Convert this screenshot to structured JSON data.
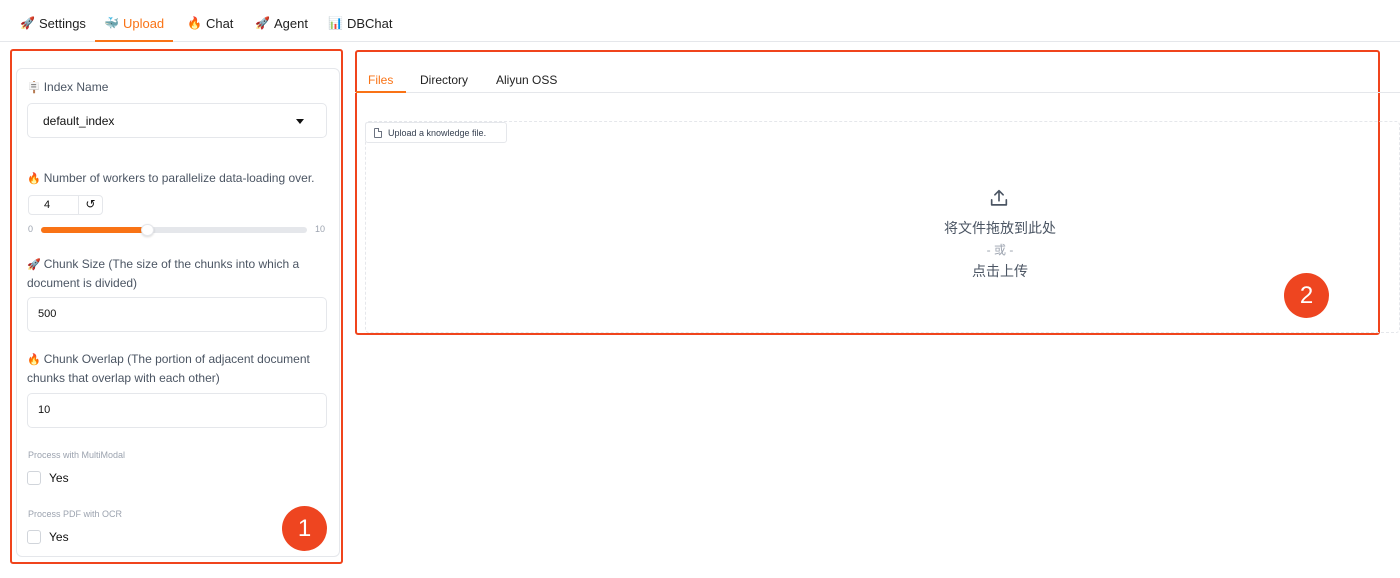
{
  "top_tabs": [
    {
      "emoji": "🚀",
      "label": "Settings"
    },
    {
      "emoji": "🐳",
      "label": "Upload"
    },
    {
      "emoji": "🔥",
      "label": "Chat"
    },
    {
      "emoji": "🚀",
      "label": "Agent"
    },
    {
      "emoji": "📊",
      "label": "DBChat"
    }
  ],
  "active_tab": "Upload",
  "left_panel": {
    "index_name": {
      "emoji": "🪧",
      "label": "Index Name",
      "value": "default_index"
    },
    "workers": {
      "emoji": "🔥",
      "label": "Number of workers to parallelize data-loading over.",
      "value": "4",
      "reset_icon": "↺",
      "min": "0",
      "max": "10",
      "fraction": 0.4
    },
    "chunk_size": {
      "emoji": "🚀",
      "label": "Chunk Size (The size of the chunks into which a document is divided)",
      "value": "500"
    },
    "chunk_overlap": {
      "emoji": "🔥",
      "label": "Chunk Overlap (The portion of adjacent document chunks that overlap with each other)",
      "value": "10"
    },
    "multimodal": {
      "caption": "Process with MultiModal",
      "option": "Yes",
      "checked": false
    },
    "ocr": {
      "caption": "Process PDF with OCR",
      "option": "Yes",
      "checked": false
    }
  },
  "right_panel": {
    "tabs": [
      "Files",
      "Directory",
      "Aliyun OSS"
    ],
    "active_tab": "Files",
    "upload_chip": "Upload a knowledge file.",
    "drop_text": "将文件拖放到此处",
    "or_text": "- 或 -",
    "click_text": "点击上传"
  },
  "badges": [
    "1",
    "2"
  ],
  "colors": {
    "accent": "#f97316",
    "highlight": "#ee4520"
  }
}
